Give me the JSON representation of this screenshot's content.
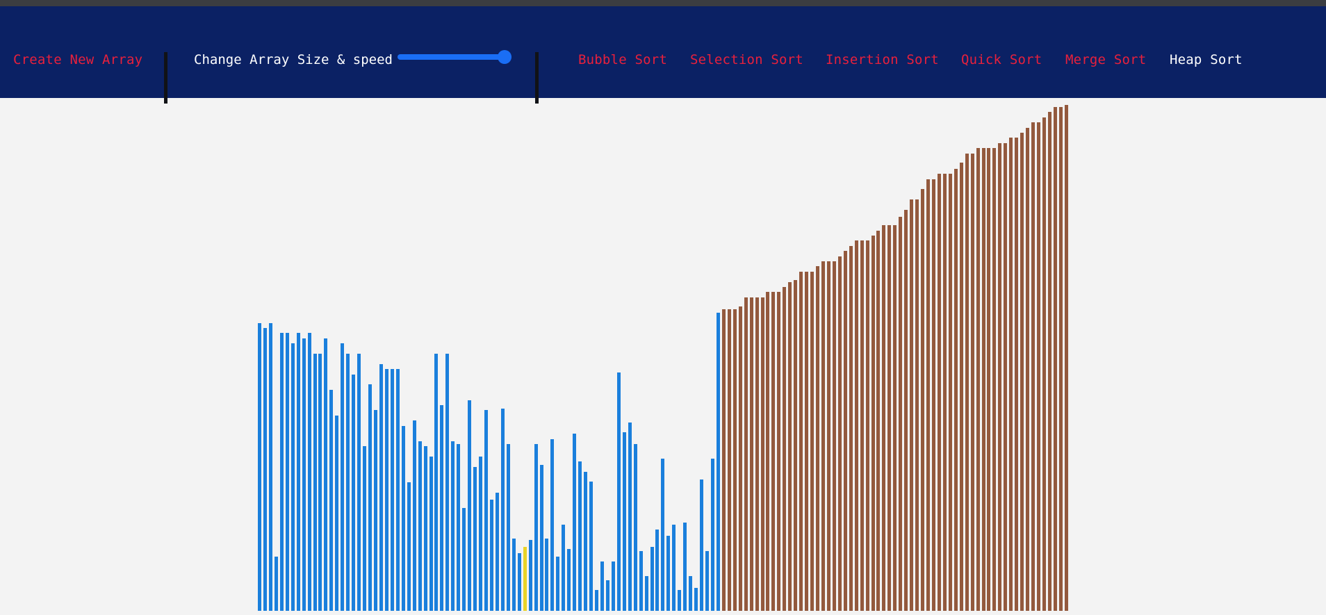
{
  "navbar": {
    "create_label": "Create New Array",
    "size_speed_label": "Change Array Size & speed",
    "slider_value_percent": 100,
    "algorithms": [
      {
        "label": "Bubble Sort",
        "active": false
      },
      {
        "label": "Selection Sort",
        "active": false
      },
      {
        "label": "Insertion Sort",
        "active": false
      },
      {
        "label": "Quick Sort",
        "active": false
      },
      {
        "label": "Merge Sort",
        "active": false
      },
      {
        "label": "Heap Sort",
        "active": true
      }
    ]
  },
  "colors": {
    "navbar_bg": "#0b2164",
    "link_inactive": "#e8203c",
    "link_active": "#ffffff",
    "bar_unsorted": "#1a7fdc",
    "bar_current": "#e9d326",
    "bar_sorted": "#93593d"
  },
  "array": {
    "values": [
      280,
      275,
      280,
      53,
      270,
      270,
      260,
      270,
      265,
      270,
      250,
      250,
      265,
      215,
      190,
      260,
      250,
      230,
      250,
      160,
      220,
      195,
      240,
      235,
      235,
      235,
      180,
      125,
      185,
      165,
      160,
      150,
      250,
      200,
      250,
      165,
      162,
      100,
      205,
      140,
      150,
      195,
      108,
      115,
      197,
      162,
      70,
      56,
      62,
      69,
      162,
      142,
      70,
      167,
      53,
      84,
      60,
      172,
      145,
      135,
      126,
      20,
      48,
      30,
      48,
      232,
      174,
      183,
      162,
      58,
      34,
      62,
      79,
      148,
      73,
      84,
      20,
      86,
      34,
      22,
      128,
      58,
      148,
      290,
      293,
      293,
      293,
      296,
      305,
      305,
      305,
      305,
      310,
      310,
      310,
      315,
      320,
      322,
      330,
      330,
      330,
      335,
      340,
      340,
      340,
      345,
      350,
      355,
      360,
      360,
      360,
      365,
      370,
      375,
      375,
      375,
      383,
      390,
      400,
      400,
      410,
      420,
      420,
      425,
      425,
      425,
      430,
      436,
      445,
      445,
      450,
      450,
      450,
      450,
      455,
      455,
      460,
      460,
      465,
      470,
      475,
      475,
      480,
      485,
      490,
      490,
      492
    ],
    "max_value": 492,
    "current_index": 48,
    "sorted_from_index": 84
  }
}
